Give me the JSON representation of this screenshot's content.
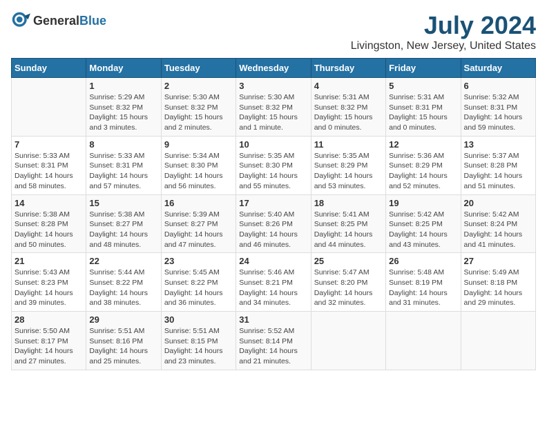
{
  "header": {
    "logo_general": "General",
    "logo_blue": "Blue",
    "month_year": "July 2024",
    "location": "Livingston, New Jersey, United States"
  },
  "days_of_week": [
    "Sunday",
    "Monday",
    "Tuesday",
    "Wednesday",
    "Thursday",
    "Friday",
    "Saturday"
  ],
  "weeks": [
    [
      {
        "day": "",
        "info": ""
      },
      {
        "day": "1",
        "info": "Sunrise: 5:29 AM\nSunset: 8:32 PM\nDaylight: 15 hours\nand 3 minutes."
      },
      {
        "day": "2",
        "info": "Sunrise: 5:30 AM\nSunset: 8:32 PM\nDaylight: 15 hours\nand 2 minutes."
      },
      {
        "day": "3",
        "info": "Sunrise: 5:30 AM\nSunset: 8:32 PM\nDaylight: 15 hours\nand 1 minute."
      },
      {
        "day": "4",
        "info": "Sunrise: 5:31 AM\nSunset: 8:32 PM\nDaylight: 15 hours\nand 0 minutes."
      },
      {
        "day": "5",
        "info": "Sunrise: 5:31 AM\nSunset: 8:31 PM\nDaylight: 15 hours\nand 0 minutes."
      },
      {
        "day": "6",
        "info": "Sunrise: 5:32 AM\nSunset: 8:31 PM\nDaylight: 14 hours\nand 59 minutes."
      }
    ],
    [
      {
        "day": "7",
        "info": "Sunrise: 5:33 AM\nSunset: 8:31 PM\nDaylight: 14 hours\nand 58 minutes."
      },
      {
        "day": "8",
        "info": "Sunrise: 5:33 AM\nSunset: 8:31 PM\nDaylight: 14 hours\nand 57 minutes."
      },
      {
        "day": "9",
        "info": "Sunrise: 5:34 AM\nSunset: 8:30 PM\nDaylight: 14 hours\nand 56 minutes."
      },
      {
        "day": "10",
        "info": "Sunrise: 5:35 AM\nSunset: 8:30 PM\nDaylight: 14 hours\nand 55 minutes."
      },
      {
        "day": "11",
        "info": "Sunrise: 5:35 AM\nSunset: 8:29 PM\nDaylight: 14 hours\nand 53 minutes."
      },
      {
        "day": "12",
        "info": "Sunrise: 5:36 AM\nSunset: 8:29 PM\nDaylight: 14 hours\nand 52 minutes."
      },
      {
        "day": "13",
        "info": "Sunrise: 5:37 AM\nSunset: 8:28 PM\nDaylight: 14 hours\nand 51 minutes."
      }
    ],
    [
      {
        "day": "14",
        "info": "Sunrise: 5:38 AM\nSunset: 8:28 PM\nDaylight: 14 hours\nand 50 minutes."
      },
      {
        "day": "15",
        "info": "Sunrise: 5:38 AM\nSunset: 8:27 PM\nDaylight: 14 hours\nand 48 minutes."
      },
      {
        "day": "16",
        "info": "Sunrise: 5:39 AM\nSunset: 8:27 PM\nDaylight: 14 hours\nand 47 minutes."
      },
      {
        "day": "17",
        "info": "Sunrise: 5:40 AM\nSunset: 8:26 PM\nDaylight: 14 hours\nand 46 minutes."
      },
      {
        "day": "18",
        "info": "Sunrise: 5:41 AM\nSunset: 8:25 PM\nDaylight: 14 hours\nand 44 minutes."
      },
      {
        "day": "19",
        "info": "Sunrise: 5:42 AM\nSunset: 8:25 PM\nDaylight: 14 hours\nand 43 minutes."
      },
      {
        "day": "20",
        "info": "Sunrise: 5:42 AM\nSunset: 8:24 PM\nDaylight: 14 hours\nand 41 minutes."
      }
    ],
    [
      {
        "day": "21",
        "info": "Sunrise: 5:43 AM\nSunset: 8:23 PM\nDaylight: 14 hours\nand 39 minutes."
      },
      {
        "day": "22",
        "info": "Sunrise: 5:44 AM\nSunset: 8:22 PM\nDaylight: 14 hours\nand 38 minutes."
      },
      {
        "day": "23",
        "info": "Sunrise: 5:45 AM\nSunset: 8:22 PM\nDaylight: 14 hours\nand 36 minutes."
      },
      {
        "day": "24",
        "info": "Sunrise: 5:46 AM\nSunset: 8:21 PM\nDaylight: 14 hours\nand 34 minutes."
      },
      {
        "day": "25",
        "info": "Sunrise: 5:47 AM\nSunset: 8:20 PM\nDaylight: 14 hours\nand 32 minutes."
      },
      {
        "day": "26",
        "info": "Sunrise: 5:48 AM\nSunset: 8:19 PM\nDaylight: 14 hours\nand 31 minutes."
      },
      {
        "day": "27",
        "info": "Sunrise: 5:49 AM\nSunset: 8:18 PM\nDaylight: 14 hours\nand 29 minutes."
      }
    ],
    [
      {
        "day": "28",
        "info": "Sunrise: 5:50 AM\nSunset: 8:17 PM\nDaylight: 14 hours\nand 27 minutes."
      },
      {
        "day": "29",
        "info": "Sunrise: 5:51 AM\nSunset: 8:16 PM\nDaylight: 14 hours\nand 25 minutes."
      },
      {
        "day": "30",
        "info": "Sunrise: 5:51 AM\nSunset: 8:15 PM\nDaylight: 14 hours\nand 23 minutes."
      },
      {
        "day": "31",
        "info": "Sunrise: 5:52 AM\nSunset: 8:14 PM\nDaylight: 14 hours\nand 21 minutes."
      },
      {
        "day": "",
        "info": ""
      },
      {
        "day": "",
        "info": ""
      },
      {
        "day": "",
        "info": ""
      }
    ]
  ]
}
